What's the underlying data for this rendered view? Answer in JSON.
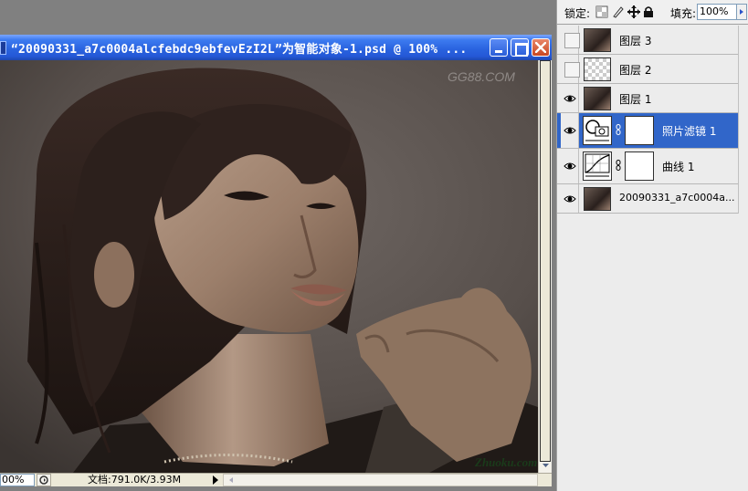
{
  "document": {
    "title": "“20090331_a7c0004alcfebdc9ebfevEzI2L”为智能对象-1.psd @ 100% ...",
    "watermark_top": "GG88.COM",
    "watermark_bottom": "Zhuoku.com",
    "zoom": "00%",
    "doc_size": "文档:791.0K/3.93M"
  },
  "panel": {
    "lock_label": "锁定:",
    "fill_label": "填充:",
    "fill_value": "100%",
    "layers": [
      {
        "name": "图层 3",
        "visible": false,
        "kind": "photo"
      },
      {
        "name": "图层 2",
        "visible": false,
        "kind": "transparent"
      },
      {
        "name": "图层 1",
        "visible": true,
        "kind": "photo"
      },
      {
        "name": "照片滤镜 1",
        "visible": true,
        "kind": "photo-filter-adjustment",
        "selected": true
      },
      {
        "name": "曲线 1",
        "visible": true,
        "kind": "curves-adjustment"
      },
      {
        "name": "20090331_a7c0004a...",
        "visible": true,
        "kind": "photo"
      }
    ]
  },
  "colors": {
    "titlebar": "#2a64e0",
    "selected_layer": "#3166c9",
    "close_button": "#c74722"
  }
}
